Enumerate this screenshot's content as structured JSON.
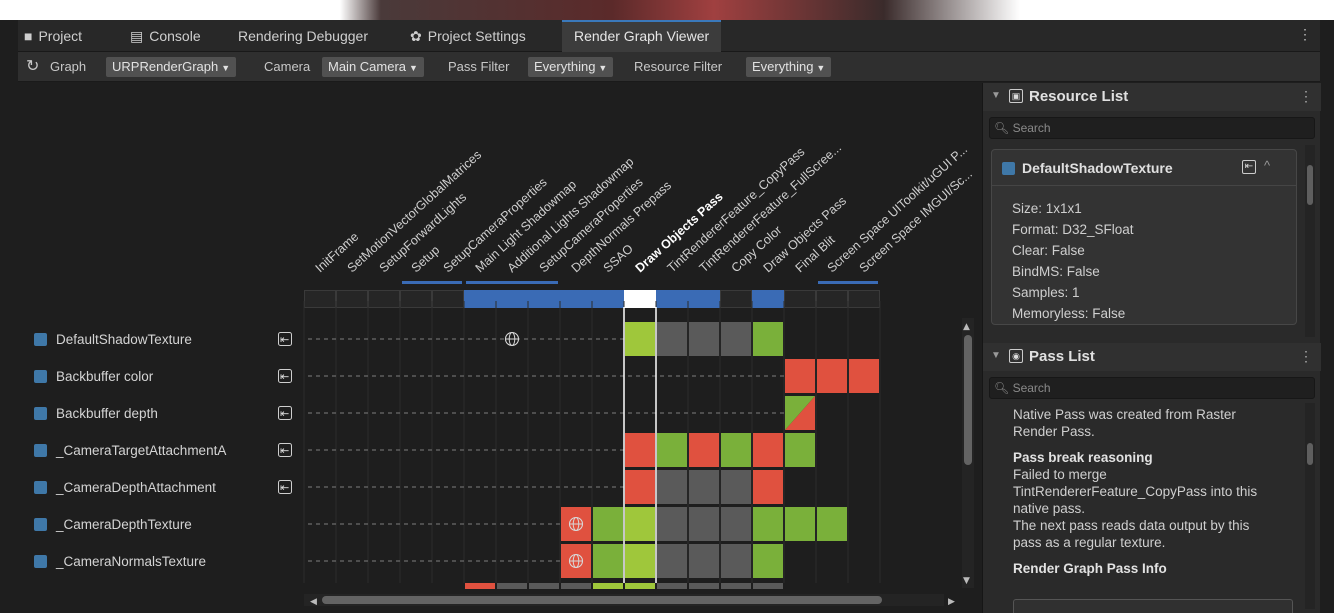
{
  "tabs": [
    {
      "label": "Project",
      "icon": "folder-icon"
    },
    {
      "label": "Console",
      "icon": "console-icon"
    },
    {
      "label": "Rendering Debugger",
      "icon": ""
    },
    {
      "label": "Project Settings",
      "icon": "gear-icon"
    },
    {
      "label": "Render Graph Viewer",
      "icon": "",
      "active": true
    }
  ],
  "toolbar": {
    "refresh_icon": "refresh-icon",
    "graph_label": "Graph",
    "graph_value": "URPRenderGraph",
    "camera_label": "Camera",
    "camera_value": "Main Camera",
    "pass_filter_label": "Pass Filter",
    "pass_filter_value": "Everything",
    "resource_filter_label": "Resource Filter",
    "resource_filter_value": "Everything"
  },
  "passes": [
    "InitFrame",
    "SetMotionVectorGlobalMatrices",
    "SetupForwardLights",
    "Setup",
    "SetupCameraProperties",
    "Main Light Shadowmap",
    "Additional Lights Shadowmap",
    "SetupCameraProperties",
    "DepthNormals Prepass",
    "SSAO",
    "Draw Objects Pass",
    "TintRendererFeature_CopyPass",
    "TintRendererFeature_FullScree...",
    "Copy Color",
    "Draw Objects Pass",
    "Final Blit",
    "Screen Space UIToolkit/uGUI P...",
    "Screen Space IMGUI/Sc..."
  ],
  "selected_pass_index": 10,
  "resources": [
    {
      "name": "DefaultShadowTexture",
      "imported": true
    },
    {
      "name": "Backbuffer color",
      "imported": true
    },
    {
      "name": "Backbuffer depth",
      "imported": true
    },
    {
      "name": "_CameraTargetAttachmentA",
      "imported": true
    },
    {
      "name": "_CameraDepthAttachment",
      "imported": true
    },
    {
      "name": "_CameraDepthTexture",
      "imported": false
    },
    {
      "name": "_CameraNormalsTexture",
      "imported": false
    }
  ],
  "colors": {
    "write": "#e0513f",
    "read": "#9fc73b",
    "readwrite": "#7ab03a",
    "unused": "#5a5a5a",
    "native_pass": "#3a6bb5",
    "selected": "#ffffff"
  },
  "resource_list": {
    "title": "Resource List",
    "search_placeholder": "Search",
    "selected": {
      "name": "DefaultShadowTexture",
      "props": [
        "Size: 1x1x1",
        "Format: D32_SFloat",
        "Clear: False",
        "BindMS: False",
        "Samples: 1",
        "Memoryless: False"
      ]
    }
  },
  "pass_list": {
    "title": "Pass List",
    "search_placeholder": "Search",
    "lines": [
      "Native Pass was created from Raster",
      "Render Pass."
    ],
    "break_title": "Pass break reasoning",
    "break_lines": [
      "Failed to merge",
      "TintRendererFeature_CopyPass into this",
      "native pass.",
      "The next pass reads data output by this",
      "pass as a regular texture."
    ],
    "info_title": "Render Graph Pass Info"
  }
}
